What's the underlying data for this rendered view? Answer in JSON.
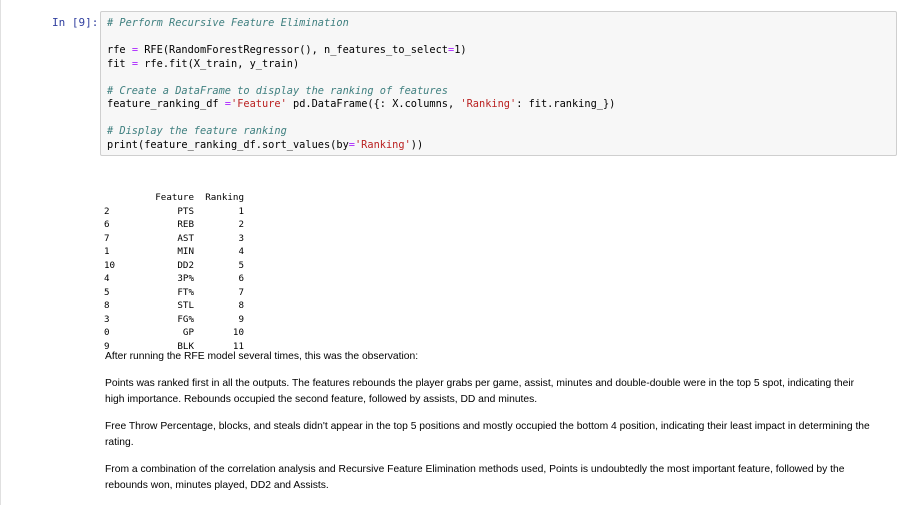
{
  "cell": {
    "prompt": "In [9]:",
    "code_lines": [
      {
        "comment": "# Perform Recursive Feature Elimination"
      },
      {
        "blank": true
      },
      {
        "pre": "rfe ",
        "op": "=",
        "post": " RFE(RandomForestRegressor(), n_features_to_select",
        "op2": "=",
        "post2": "1)"
      },
      {
        "pre": "fit ",
        "op": "=",
        "post": " rfe.fit(X_train, y_train)"
      },
      {
        "blank": true
      },
      {
        "comment": "# Create a DataFrame to display the ranking of features"
      },
      {
        "pre": "feature_ranking_df ",
        "op": "=",
        "post": " pd.DataFrame({",
        "str1": "'Feature'",
        "mid": ": X.columns, ",
        "str2": "'Ranking'",
        "post2": ": fit.ranking_})"
      },
      {
        "blank": true
      },
      {
        "comment": "# Display the feature ranking"
      },
      {
        "pre": "print(feature_ranking_df.sort_values(by",
        "op": "=",
        "str1": "'Ranking'",
        "post": "))"
      }
    ]
  },
  "output": {
    "headers": {
      "index": "",
      "feature": "Feature",
      "ranking": "Ranking"
    },
    "rows": [
      {
        "index": "2",
        "feature": "PTS",
        "ranking": "1"
      },
      {
        "index": "6",
        "feature": "REB",
        "ranking": "2"
      },
      {
        "index": "7",
        "feature": "AST",
        "ranking": "3"
      },
      {
        "index": "1",
        "feature": "MIN",
        "ranking": "4"
      },
      {
        "index": "10",
        "feature": "DD2",
        "ranking": "5"
      },
      {
        "index": "4",
        "feature": "3P%",
        "ranking": "6"
      },
      {
        "index": "5",
        "feature": "FT%",
        "ranking": "7"
      },
      {
        "index": "8",
        "feature": "STL",
        "ranking": "8"
      },
      {
        "index": "3",
        "feature": "FG%",
        "ranking": "9"
      },
      {
        "index": "0",
        "feature": "GP",
        "ranking": "10"
      },
      {
        "index": "9",
        "feature": "BLK",
        "ranking": "11"
      }
    ]
  },
  "markdown": {
    "p1": "After running the RFE model several times, this was the observation:",
    "p2": "Points was ranked first in all the outputs. The features rebounds the player grabs per game, assist, minutes and double-double were in the top 5 spot, indicating their high importance. Rebounds occupied the second feature, followed by assists, DD and minutes.",
    "p3": "Free Throw Percentage, blocks, and steals didn't appear in the top 5 positions and mostly occupied the bottom 4 position, indicating their least impact in determining the rating.",
    "p4": "From a combination of the correlation analysis and Recursive Feature Elimination methods used, Points is undoubtedly the most important feature, followed by the rebounds won, minutes played, DD2 and Assists."
  }
}
